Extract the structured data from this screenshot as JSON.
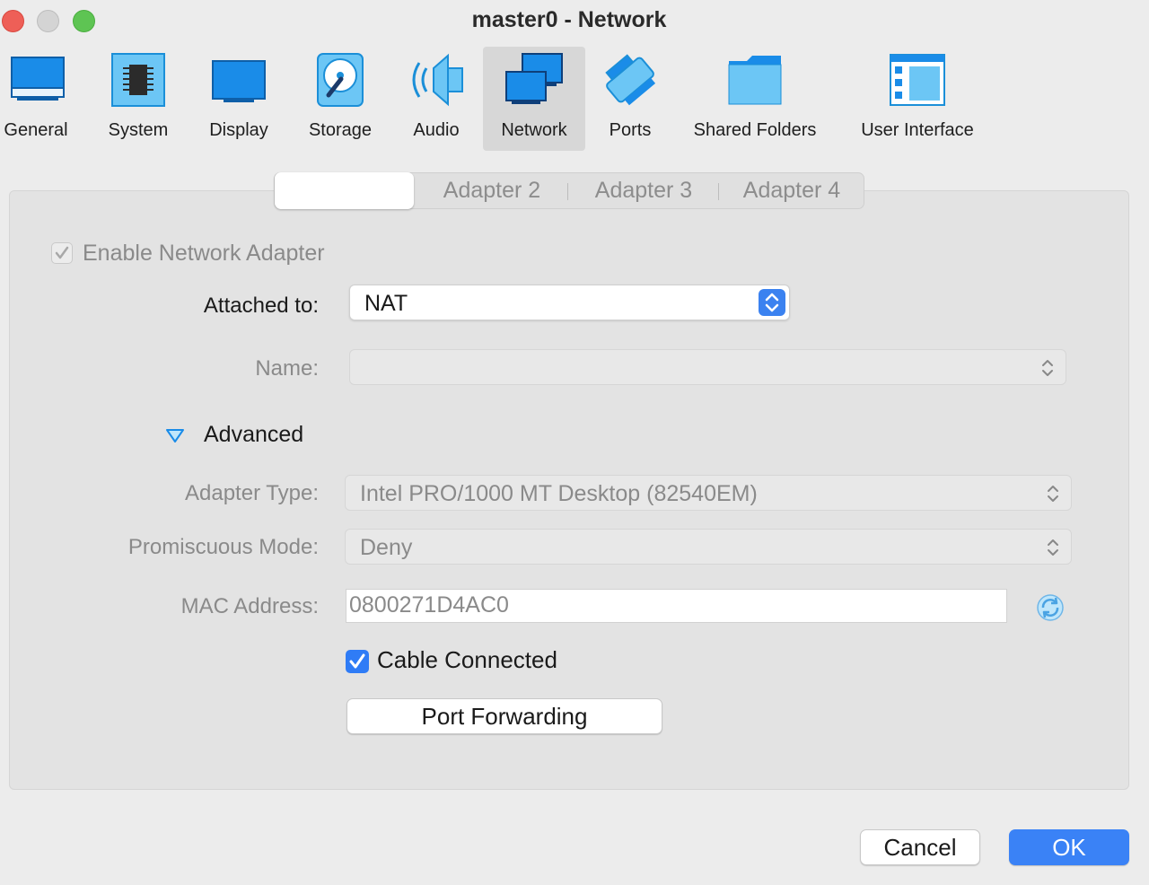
{
  "window": {
    "title": "master0 - Network"
  },
  "toolbar": {
    "items": [
      {
        "label": "General"
      },
      {
        "label": "System"
      },
      {
        "label": "Display"
      },
      {
        "label": "Storage"
      },
      {
        "label": "Audio"
      },
      {
        "label": "Network",
        "active": true
      },
      {
        "label": "Ports"
      },
      {
        "label": "Shared Folders"
      },
      {
        "label": "User Interface"
      }
    ]
  },
  "adapter_tabs": [
    {
      "label": "",
      "selected": true
    },
    {
      "label": "Adapter 2"
    },
    {
      "label": "Adapter 3"
    },
    {
      "label": "Adapter 4"
    }
  ],
  "form": {
    "enable_adapter": {
      "label": "Enable Network Adapter",
      "checked": true,
      "enabled": false
    },
    "attached_to": {
      "label": "Attached to:",
      "value": "NAT"
    },
    "name": {
      "label": "Name:",
      "value": ""
    },
    "advanced": {
      "label": "Advanced",
      "expanded": true
    },
    "adapter_type": {
      "label": "Adapter Type:",
      "value": "Intel PRO/1000 MT Desktop (82540EM)"
    },
    "promiscuous_mode": {
      "label": "Promiscuous Mode:",
      "value": "Deny"
    },
    "mac_address": {
      "label": "MAC Address:",
      "value": "0800271D4AC0"
    },
    "cable_connected": {
      "label": "Cable Connected",
      "checked": true
    },
    "port_forwarding": {
      "label": "Port Forwarding"
    }
  },
  "footer": {
    "cancel_label": "Cancel",
    "ok_label": "OK"
  },
  "colors": {
    "accent": "#3a82f6",
    "icon_blue": "#1a8ce8",
    "icon_light": "#6cc6f5"
  }
}
